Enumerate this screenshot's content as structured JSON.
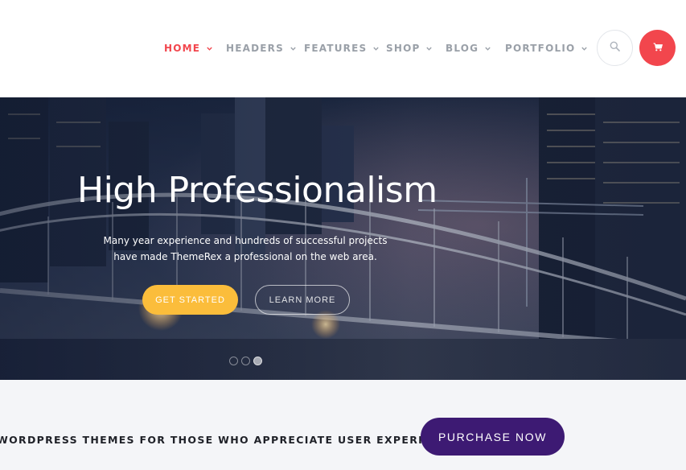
{
  "nav": {
    "items": [
      {
        "label": "HOME"
      },
      {
        "label": "HEADERS"
      },
      {
        "label": "FEATURES"
      },
      {
        "label": "SHOP"
      },
      {
        "label": "BLOG"
      },
      {
        "label": "PORTFOLIO"
      }
    ],
    "active_color": "#f2464d",
    "inactive_color": "#9aa0a8"
  },
  "header_icons": {
    "search": "search-icon",
    "cart": "cart-icon",
    "cart_color": "#f2464d"
  },
  "hero": {
    "title": "High Professionalism",
    "subtitle_line1": "Many year experience and hundreds of successful projects",
    "subtitle_line2": "have made ThemeRex a professional on the web area.",
    "primary_button": "GET STARTED",
    "secondary_button": "LEARN MORE",
    "primary_color": "#fbbd3b",
    "slides": 3,
    "active_slide": 3
  },
  "band": {
    "text": "WORDPRESS THEMES FOR THOSE WHO APPRECIATE USER EXPERIENCE",
    "button": "PURCHASE NOW",
    "button_color": "#3d1a73",
    "background": "#f4f5f8"
  }
}
